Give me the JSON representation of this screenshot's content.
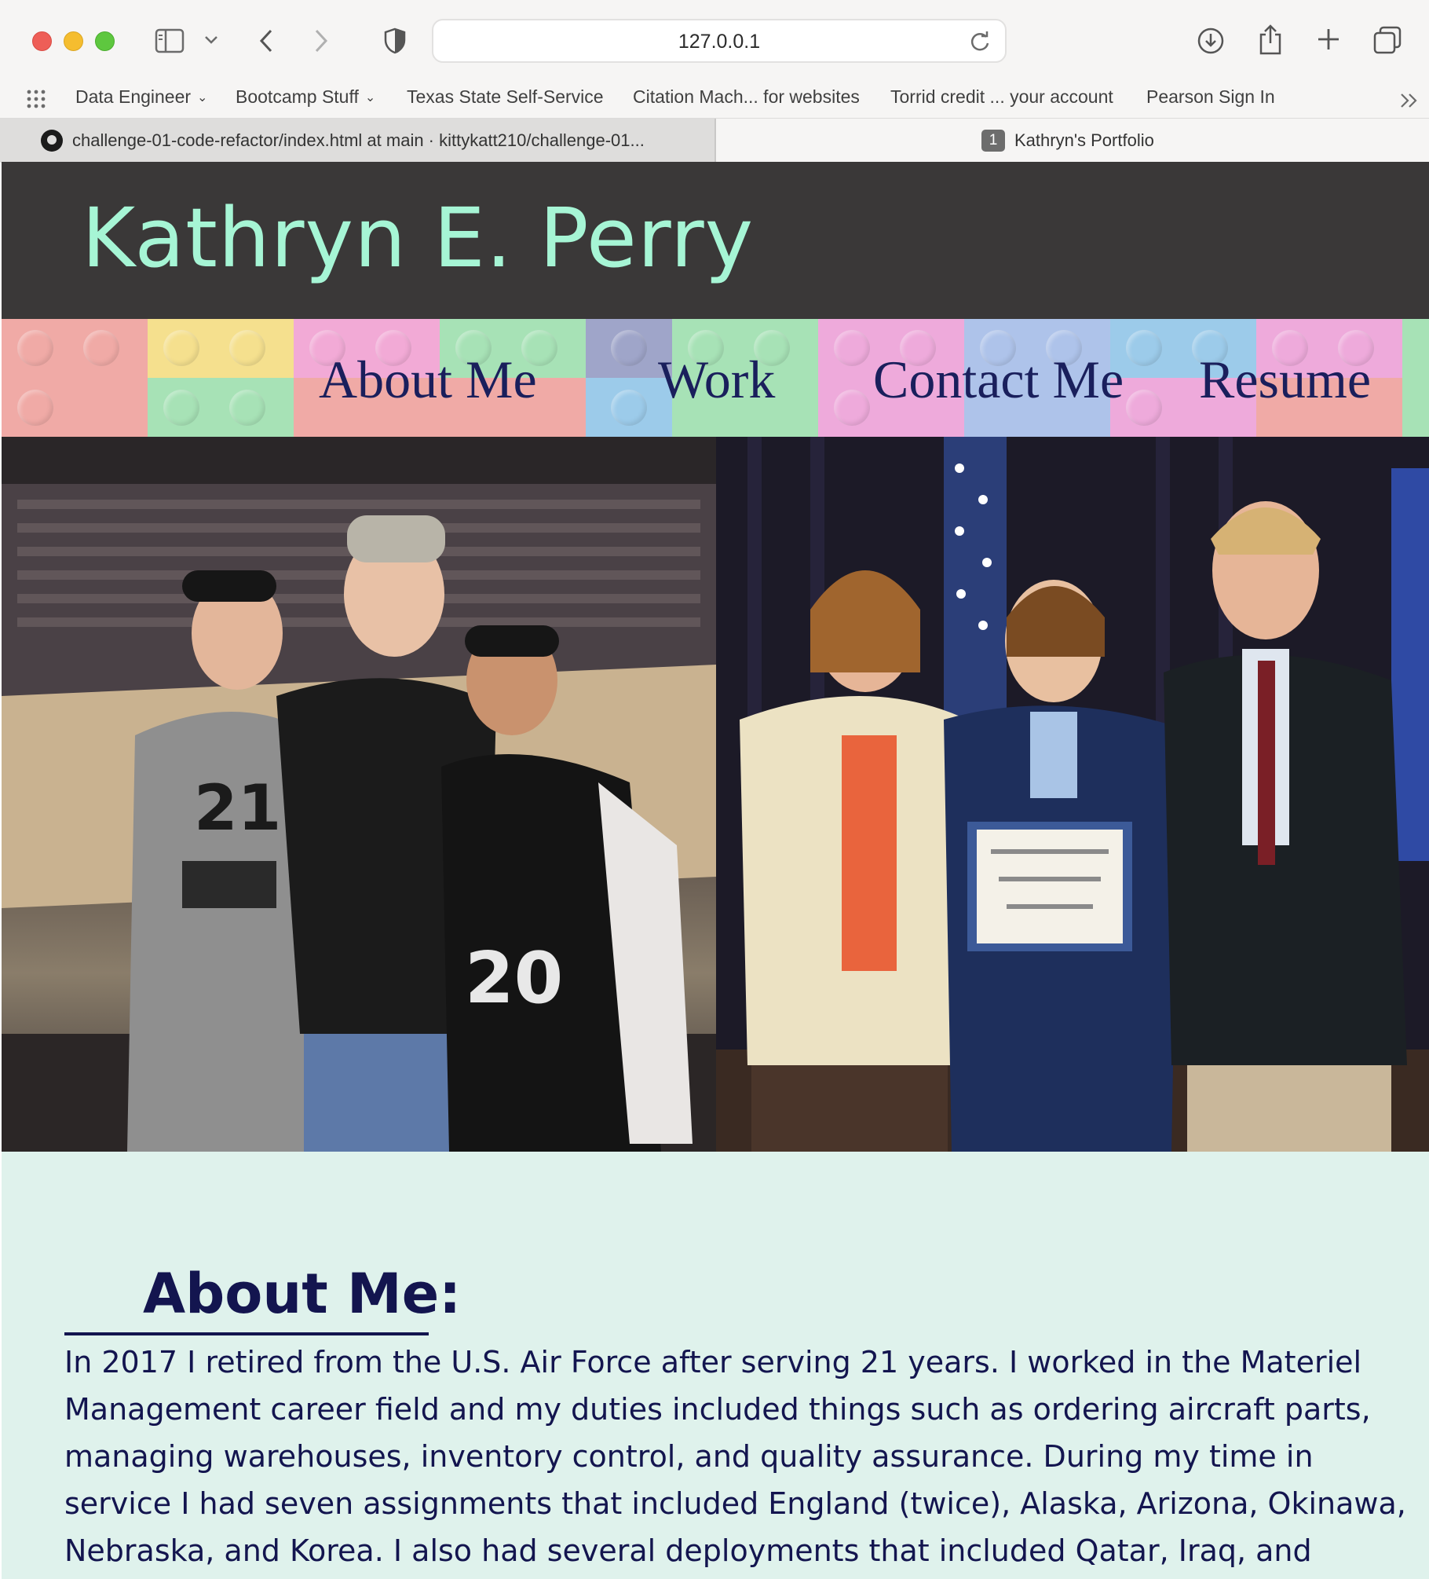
{
  "browser": {
    "url": "127.0.0.1",
    "bookmarks": [
      {
        "label": "Data Engineer",
        "has_menu": true
      },
      {
        "label": "Bootcamp Stuff",
        "has_menu": true
      },
      {
        "label": "Texas State Self-Service",
        "has_menu": false
      },
      {
        "label": "Citation Mach... for websites",
        "has_menu": false
      },
      {
        "label": "Torrid credit ... your account",
        "has_menu": false
      },
      {
        "label": "Pearson Sign In",
        "has_menu": false
      }
    ],
    "tabs": [
      {
        "label": "challenge-01-code-refactor/index.html at main · kittykatt210/challenge-01...",
        "icon": "github-icon",
        "active": false
      },
      {
        "label": "Kathryn's Portfolio",
        "badge": "1",
        "active": true
      }
    ]
  },
  "site": {
    "title": "Kathryn E. Perry",
    "nav": [
      {
        "label": "About Me"
      },
      {
        "label": "Work"
      },
      {
        "label": "Contact Me"
      },
      {
        "label": "Resume"
      }
    ],
    "hero_images": [
      {
        "alt": "Photo at basketball arena with family in Spurs jerseys",
        "icon": "photo-icon"
      },
      {
        "alt": "Air Force certificate award photo",
        "icon": "photo-icon"
      }
    ],
    "about": {
      "heading": "About Me:",
      "text": "In 2017 I retired from the U.S. Air Force after serving 21 years. I worked in the Materiel Management career field and my duties included things such as ordering aircraft parts, managing warehouses, inventory control, and quality assurance. During my time in service I had seven assignments that included England (twice), Alaska, Arizona, Okinawa, Nebraska, and Korea. I also had several deployments that included Qatar, Iraq, and"
    }
  },
  "colors": {
    "header_bg": "#3a3838",
    "title_color": "#a6f5d5",
    "nav_text": "#1a1f5c",
    "about_bg": "#dff2ec",
    "about_text": "#13154f"
  }
}
